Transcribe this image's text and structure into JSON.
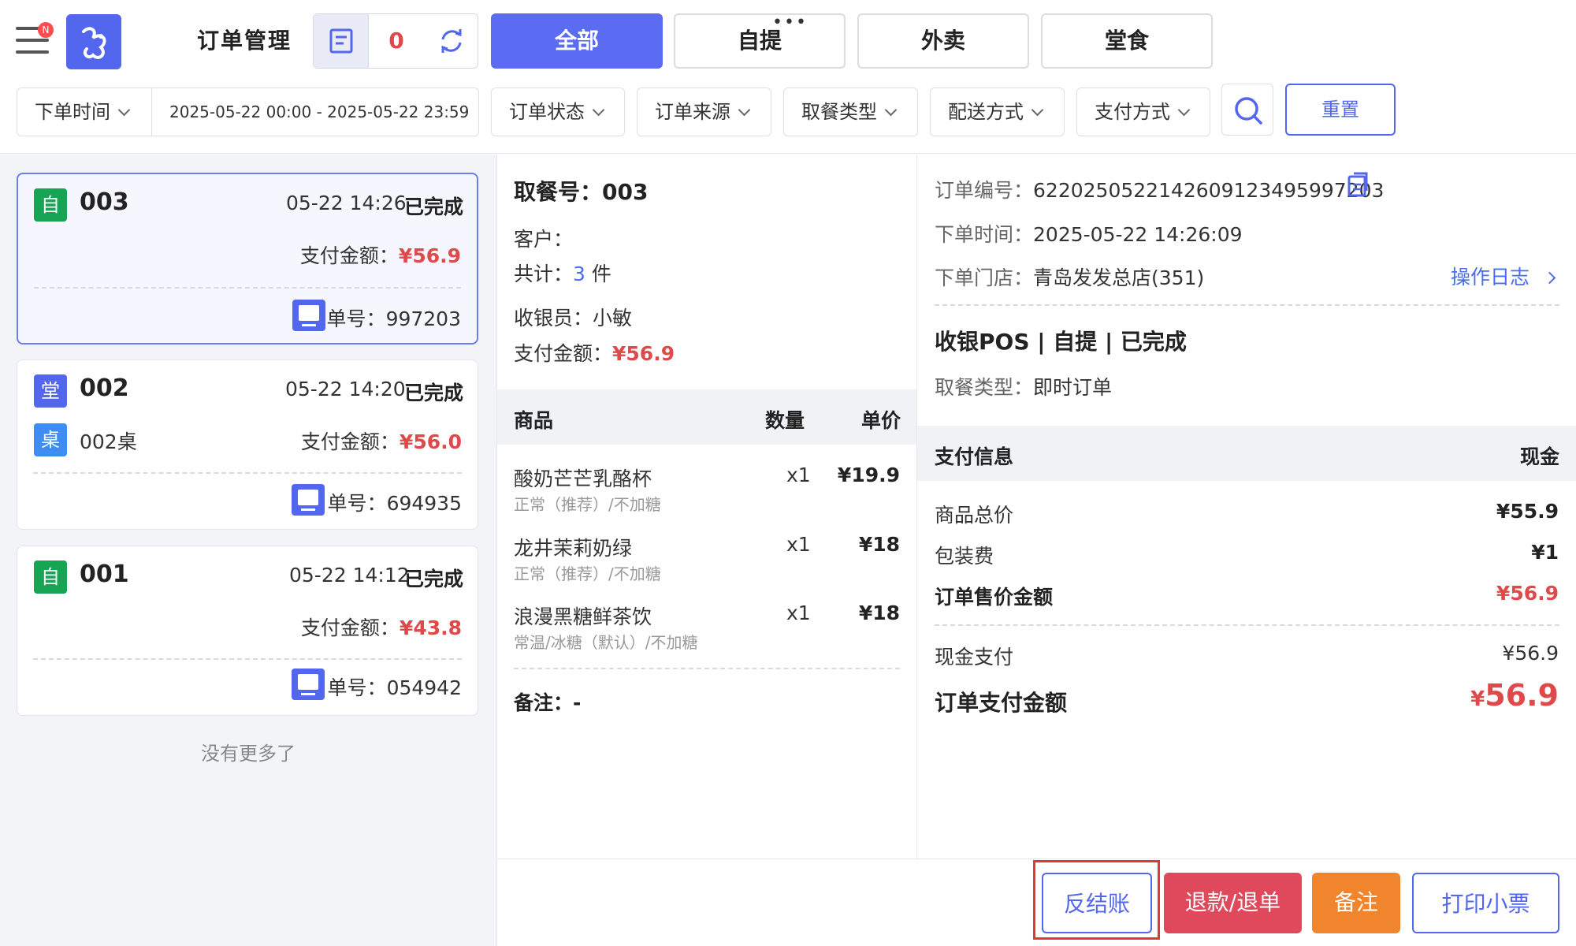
{
  "header": {
    "badge": "N",
    "title": "订单管理",
    "pending_count": "0",
    "tabs": [
      {
        "label": "全部",
        "active": true
      },
      {
        "label": "自提",
        "active": false
      },
      {
        "label": "外卖",
        "active": false
      },
      {
        "label": "堂食",
        "active": false
      }
    ],
    "tab_more": "•••"
  },
  "filters": {
    "time_type": "下单时间",
    "date_range": "2025-05-22 00:00 - 2025-05-22 23:59",
    "dropdowns": [
      "订单状态",
      "订单来源",
      "取餐类型",
      "配送方式",
      "支付方式"
    ],
    "reset_label": "重置"
  },
  "orders": [
    {
      "tag": "自",
      "number": "003",
      "time": "05-22 14:26",
      "status": "已完成",
      "table": "",
      "pay_label": "支付金额：",
      "amount": "¥56.9",
      "order_label": "单号：",
      "order_no": "997203",
      "selected": true
    },
    {
      "tag": "堂",
      "number": "002",
      "time": "05-22 14:20",
      "status": "已完成",
      "table_tag": "桌",
      "table": "002桌",
      "pay_label": "支付金额：",
      "amount": "¥56.0",
      "order_label": "单号：",
      "order_no": "694935",
      "selected": false
    },
    {
      "tag": "自",
      "number": "001",
      "time": "05-22 14:12",
      "status": "已完成",
      "table": "",
      "pay_label": "支付金额：",
      "amount": "¥43.8",
      "order_label": "单号：",
      "order_no": "054942",
      "selected": false
    }
  ],
  "no_more": "没有更多了",
  "detail": {
    "pickup_label": "取餐号：",
    "pickup_no": "003",
    "customer_label": "客户：",
    "total_label": "共计：",
    "total_count": "3",
    "total_unit": "件",
    "cashier_label": "收银员：",
    "cashier": "小敏",
    "pay_label": "支付金额：",
    "pay_amount": "¥56.9",
    "table_headers": {
      "item": "商品",
      "qty": "数量",
      "price": "单价"
    },
    "items": [
      {
        "name": "酸奶芒芒乳酪杯",
        "spec": "正常（推荐）/不加糖",
        "qty": "x1",
        "price": "¥19.9"
      },
      {
        "name": "龙井茉莉奶绿",
        "spec": "正常（推荐）/不加糖",
        "qty": "x1",
        "price": "¥18"
      },
      {
        "name": "浪漫黑糖鲜茶饮",
        "spec": "常温/冰糖（默认）/不加糖",
        "qty": "x1",
        "price": "¥18"
      }
    ],
    "remark_label": "备注：",
    "remark": "-"
  },
  "info": {
    "order_no_label": "订单编号：",
    "order_no": "6220250522142609123495997203",
    "order_time_label": "下单时间：",
    "order_time": "2025-05-22 14:26:09",
    "store_label": "下单门店：",
    "store": "青岛发发总店(351)",
    "log_link": "操作日志",
    "summary": "收银POS | 自提 | 已完成",
    "meal_type_label": "取餐类型：",
    "meal_type": "即时订单",
    "payment_header": "支付信息",
    "payment_method": "现金",
    "goods_total_label": "商品总价",
    "goods_total": "¥55.9",
    "packing_label": "包装费",
    "packing": "¥1",
    "sale_label": "订单售价金额",
    "sale": "¥56.9",
    "cash_label": "现金支付",
    "cash": "¥56.9",
    "paid_label": "订单支付金额",
    "paid_symbol": "¥",
    "paid": "56.9"
  },
  "actions": {
    "reverse": "反结账",
    "refund": "退款/退单",
    "note": "备注",
    "print": "打印小票"
  },
  "colors": {
    "primary": "#5266ee",
    "danger": "#e0494a",
    "success": "#17a454",
    "warning": "#f0852e"
  }
}
